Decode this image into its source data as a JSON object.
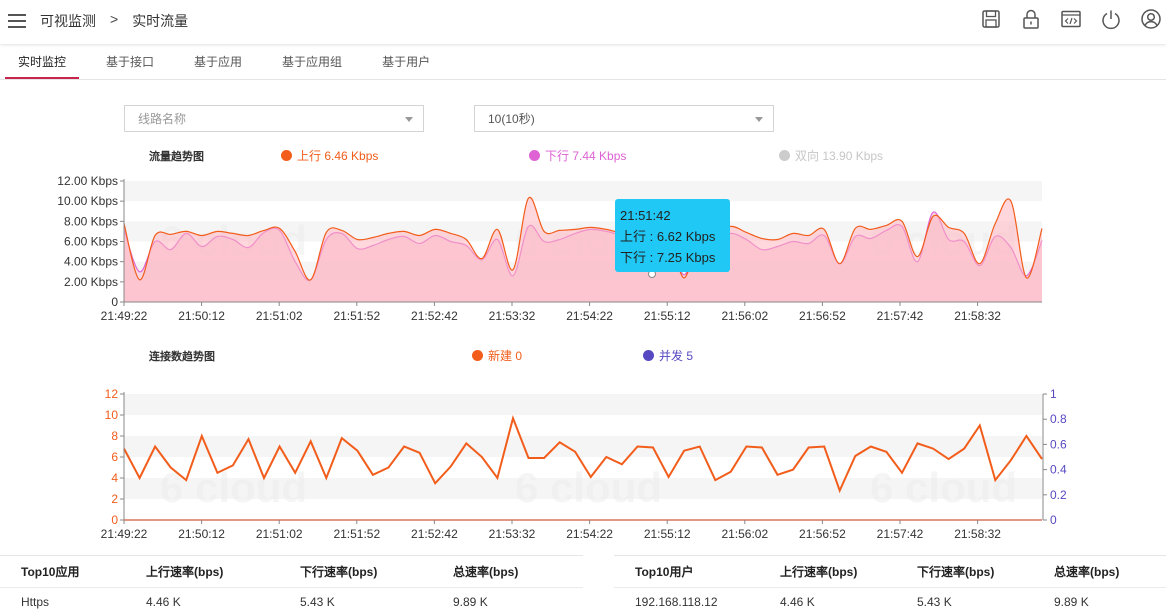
{
  "header": {
    "breadcrumb": [
      "可视监测",
      "实时流量"
    ],
    "separator": ">",
    "icons": [
      "save-icon",
      "lock-icon",
      "code-icon",
      "power-icon",
      "user-icon"
    ]
  },
  "tabs": [
    {
      "label": "实时监控",
      "active": true
    },
    {
      "label": "基于接口",
      "active": false
    },
    {
      "label": "基于应用",
      "active": false
    },
    {
      "label": "基于应用组",
      "active": false
    },
    {
      "label": "基于用户",
      "active": false
    }
  ],
  "filters": {
    "line_placeholder": "线路名称",
    "interval_value": "10(10秒)"
  },
  "colors": {
    "upload": "#f25d1b",
    "download": "#de62d3",
    "bidirectional": "#cccccc",
    "new_conn": "#f25d1b",
    "concurrent": "#5649c2",
    "tab_accent": "#c6244a",
    "tooltip": "#1fc8f5"
  },
  "traffic_chart": {
    "title": "流量趋势图",
    "legend": {
      "upload": "上行 6.46 Kbps",
      "download": "下行 7.44 Kbps",
      "bidirectional": "双向 13.90 Kbps"
    },
    "tooltip": {
      "time": "21:51:42",
      "upload": "上行 : 6.62 Kbps",
      "download": "下行 : 7.25 Kbps"
    }
  },
  "connection_chart": {
    "title": "连接数趋势图",
    "legend": {
      "new_conn": "新建 0",
      "concurrent": "并发 5"
    }
  },
  "chart_data": [
    {
      "type": "area",
      "title": "流量趋势图",
      "x_ticks": [
        "21:49:22",
        "21:50:12",
        "21:51:02",
        "21:51:52",
        "21:52:42",
        "21:53:32",
        "21:54:22",
        "21:55:12",
        "21:56:02",
        "21:56:52",
        "21:57:42",
        "21:58:32"
      ],
      "y_ticks": [
        "0",
        "2.00 Kbps",
        "4.00 Kbps",
        "6.00 Kbps",
        "8.00 Kbps",
        "10.00 Kbps",
        "12.00 Kbps"
      ],
      "ylim": [
        0,
        12
      ],
      "x_index_range": [
        0,
        59
      ],
      "series": [
        {
          "name": "上行",
          "values": [
            7.2,
            3.0,
            6.0,
            5.2,
            6.8,
            5.5,
            6.5,
            6.2,
            5.4,
            6.9,
            7.1,
            4.0,
            2.2,
            6.2,
            6.8,
            5.3,
            5.6,
            6.2,
            6.5,
            5.8,
            6.6,
            6.0,
            5.6,
            4.2,
            6.2,
            2.6,
            7.5,
            6.0,
            6.2,
            6.8,
            7.2,
            7.0,
            6.6,
            6.2,
            5.8,
            6.3,
            2.7,
            6.4,
            6.0,
            6.8,
            6.2,
            5.2,
            5.5,
            6.0,
            5.8,
            6.6,
            3.8,
            6.5,
            6.3,
            7.1,
            7.5,
            4.0,
            8.9,
            6.2,
            6.0,
            3.6,
            6.5,
            5.4,
            2.6,
            6.1
          ]
        },
        {
          "name": "下行",
          "values": [
            7.8,
            2.2,
            6.6,
            6.7,
            7.0,
            6.6,
            7.0,
            6.8,
            6.6,
            7.1,
            7.3,
            5.0,
            2.2,
            6.9,
            7.1,
            6.2,
            6.4,
            6.8,
            7.0,
            6.6,
            7.2,
            6.8,
            6.2,
            4.3,
            7.2,
            3.2,
            10.3,
            7.0,
            7.1,
            7.2,
            7.4,
            7.2,
            6.9,
            7.3,
            6.7,
            7.0,
            2.4,
            7.0,
            6.6,
            7.5,
            6.9,
            6.3,
            6.2,
            6.8,
            6.6,
            7.2,
            3.8,
            7.3,
            7.2,
            7.6,
            8.0,
            4.5,
            8.5,
            7.4,
            6.8,
            3.8,
            7.8,
            10.0,
            2.4,
            7.3
          ]
        }
      ]
    },
    {
      "type": "area",
      "title": "连接数趋势图",
      "x_ticks": [
        "21:49:22",
        "21:50:12",
        "21:51:02",
        "21:51:52",
        "21:52:42",
        "21:53:32",
        "21:54:22",
        "21:55:12",
        "21:56:02",
        "21:56:52",
        "21:57:42",
        "21:58:32"
      ],
      "y_left_ticks": [
        "0",
        "2",
        "4",
        "6",
        "8",
        "10",
        "12"
      ],
      "y_right_ticks": [
        "0",
        "0.2",
        "0.4",
        "0.6",
        "0.8",
        "1"
      ],
      "ylim_left": [
        0,
        12
      ],
      "ylim_right": [
        0,
        1
      ],
      "x_index_range": [
        0,
        59
      ],
      "series": [
        {
          "name": "新建",
          "axis": "left",
          "values": [
            0,
            0,
            0,
            0,
            0,
            0,
            0,
            0,
            0,
            0,
            0,
            0,
            0,
            0,
            0,
            0,
            0,
            0,
            0,
            0,
            0,
            0,
            0,
            0,
            0,
            0,
            0,
            0,
            0,
            0,
            0,
            0,
            0,
            0,
            0,
            0,
            0,
            0,
            0,
            0,
            0,
            0,
            0,
            0,
            0,
            0,
            0,
            0,
            0,
            0,
            0,
            0,
            0,
            0,
            0,
            0,
            0,
            0,
            0,
            0
          ]
        },
        {
          "name": "并发",
          "axis": "left",
          "values": [
            6.8,
            4.0,
            7.0,
            5.0,
            3.8,
            8.0,
            4.5,
            5.2,
            7.7,
            4.0,
            7.0,
            4.5,
            7.5,
            4.0,
            7.8,
            6.6,
            4.3,
            5.0,
            7.0,
            6.4,
            3.5,
            5.1,
            7.3,
            6.0,
            4.0,
            9.7,
            5.9,
            5.9,
            7.4,
            6.5,
            4.1,
            6.0,
            5.3,
            7.0,
            6.9,
            4.1,
            6.6,
            7.0,
            3.8,
            4.6,
            7.0,
            6.9,
            4.3,
            4.8,
            6.9,
            7.0,
            2.8,
            6.1,
            7.0,
            6.5,
            4.5,
            7.3,
            6.8,
            5.8,
            6.8,
            9.0,
            3.8,
            5.7,
            8.0,
            5.8
          ]
        }
      ]
    }
  ],
  "tables": {
    "apps": {
      "headers": [
        "Top10应用",
        "上行速率(bps)",
        "下行速率(bps)",
        "总速率(bps)"
      ],
      "row": [
        "Https",
        "4.46 K",
        "5.43 K",
        "9.89 K"
      ]
    },
    "users": {
      "headers": [
        "Top10用户",
        "上行速率(bps)",
        "下行速率(bps)",
        "总速率(bps)"
      ],
      "row": [
        "192.168.118.12",
        "4.46 K",
        "5.43 K",
        "9.89 K"
      ]
    }
  }
}
